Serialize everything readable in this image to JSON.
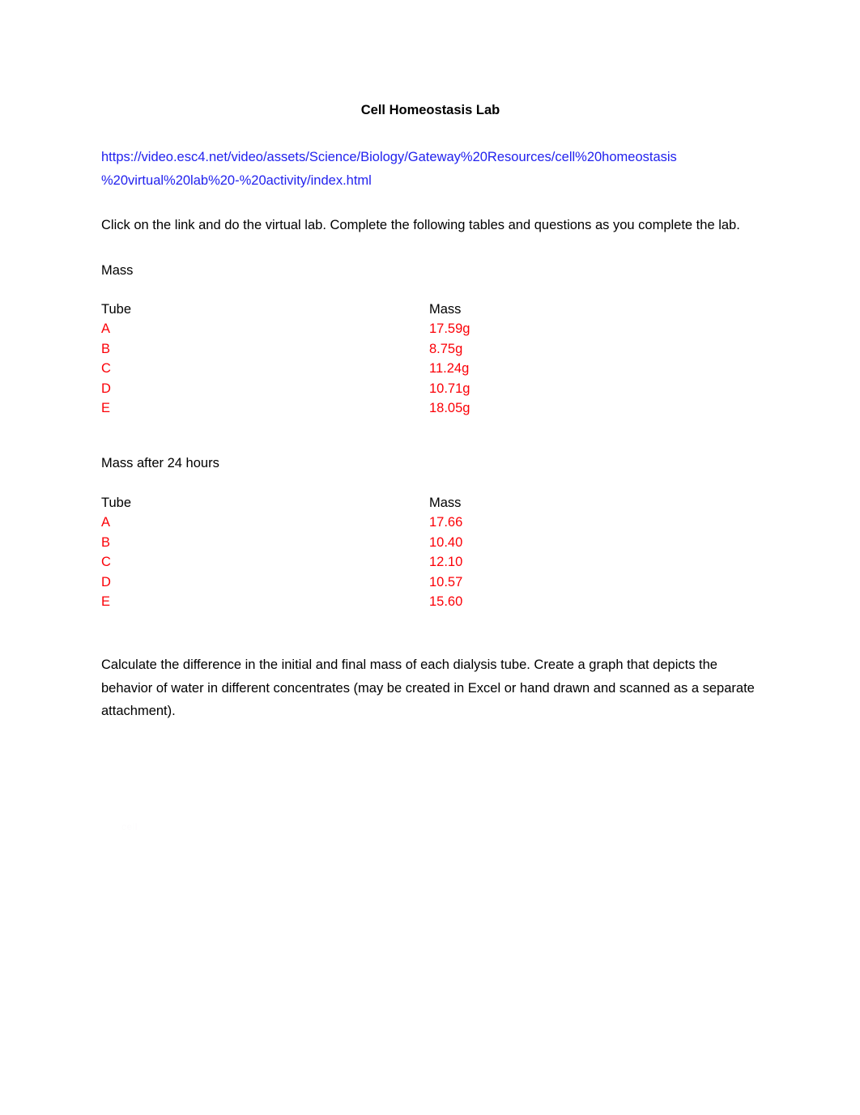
{
  "document": {
    "title": "Cell Homeostasis Lab",
    "link": {
      "line1": "https://video.esc4.net/video/assets/Science/Biology/Gateway%20Resources/cell%20homeostasis",
      "line2": "%20virtual%20lab%20-%20activity/index.html",
      "color": "#2222ee"
    },
    "intro_paragraph": "Click on the link and do the virtual lab.  Complete the following tables and questions as you complete the lab.",
    "section_one": {
      "label": "Mass",
      "headers": [
        "Tube",
        "Mass"
      ],
      "rows": [
        {
          "tube": "A",
          "mass": "17.59g"
        },
        {
          "tube": "B",
          "mass": "8.75g"
        },
        {
          "tube": "C",
          "mass": "11.24g"
        },
        {
          "tube": "D",
          "mass": "10.71g"
        },
        {
          "tube": "E",
          "mass": "18.05g"
        }
      ]
    },
    "section_two": {
      "label": "Mass after 24 hours",
      "headers": [
        "Tube",
        "Mass"
      ],
      "rows": [
        {
          "tube": "A",
          "mass": "17.66"
        },
        {
          "tube": "B",
          "mass": "10.40"
        },
        {
          "tube": "C",
          "mass": "12.10"
        },
        {
          "tube": "D",
          "mass": "10.57"
        },
        {
          "tube": "E",
          "mass": "15.60"
        }
      ]
    },
    "closing_paragraph": "Calculate the difference in the initial and final mass of each dialysis tube.  Create a graph that depicts the behavior of water in different concentrates (may be created in Excel or hand drawn and scanned as a separate attachment).",
    "answer_color": "#fb0007",
    "ghost_text": "cell"
  }
}
